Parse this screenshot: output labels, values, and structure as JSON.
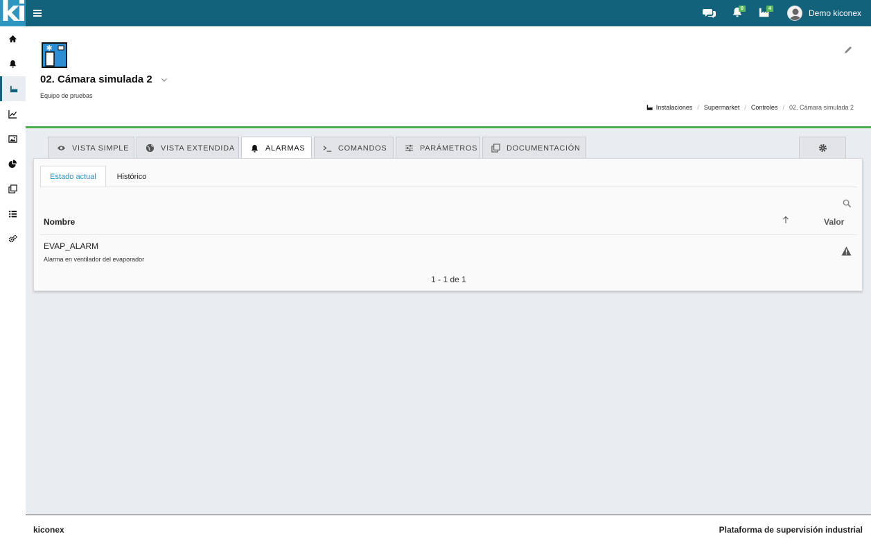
{
  "topbar": {
    "logo_text": "ki",
    "messages_icon": "comments-icon",
    "notifications_icon": "bell-icon",
    "notifications_count": "0",
    "installations_icon": "industry-icon",
    "installations_count": "4",
    "user_name": "Demo kiconex"
  },
  "sidebar": {
    "items": [
      {
        "icon": "home-icon"
      },
      {
        "icon": "bell-icon"
      },
      {
        "icon": "industry-icon",
        "active": true
      },
      {
        "icon": "line-chart-icon"
      },
      {
        "icon": "image-icon"
      },
      {
        "icon": "pie-chart-icon"
      },
      {
        "icon": "clone-icon"
      },
      {
        "icon": "list-icon"
      },
      {
        "icon": "cogs-icon"
      }
    ]
  },
  "header": {
    "title": "02. Cámara simulada 2",
    "subtitle": "Equipo de pruebas",
    "breadcrumb": [
      "Instalaciones",
      "Supermarket",
      "Controles",
      "02. Cámara simulada 2"
    ]
  },
  "tabs": [
    {
      "label": "VISTA SIMPLE",
      "icon": "eye-icon"
    },
    {
      "label": "VISTA EXTENDIDA",
      "icon": "globe-icon"
    },
    {
      "label": "ALARMAS",
      "icon": "bell-icon",
      "active": true
    },
    {
      "label": "COMANDOS",
      "icon": "terminal-icon"
    },
    {
      "label": "PARÁMETROS",
      "icon": "sliders-icon"
    },
    {
      "label": "DOCUMENTACIÓN",
      "icon": "copy-icon"
    }
  ],
  "alarms": {
    "subtabs": [
      "Estado actual",
      "Histórico"
    ],
    "columns": {
      "name": "Nombre",
      "value": "Valor"
    },
    "rows": [
      {
        "name": "EVAP_ALARM",
        "description": "Alarma en ventilador del evaporador",
        "value_icon": "warning-icon"
      }
    ],
    "pagination": "1 - 1 de 1"
  },
  "footer": {
    "left": "kiconex",
    "right": "Plataforma de supervisión industrial"
  },
  "colors": {
    "topbar": "#13627c",
    "logo": "#2d95bf",
    "accent_green": "#4cae4c",
    "active_subtab": "#2c8ec7"
  }
}
